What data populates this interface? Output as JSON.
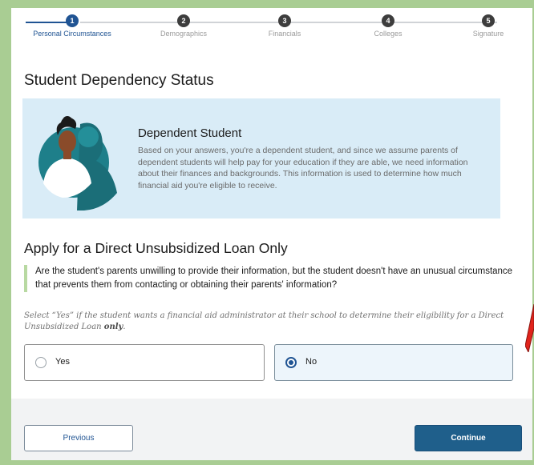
{
  "stepper": {
    "steps": [
      {
        "number": "1",
        "label": "Personal Circumstances"
      },
      {
        "number": "2",
        "label": "Demographics"
      },
      {
        "number": "3",
        "label": "Financials"
      },
      {
        "number": "4",
        "label": "Colleges"
      },
      {
        "number": "5",
        "label": "Signature"
      }
    ],
    "active_step": 1
  },
  "page_title": "Student Dependency Status",
  "info_box": {
    "title": "Dependent Student",
    "body": "Based on your answers, you're a dependent student, and since we assume parents of dependent students will help pay for your education if they are able, we need information about their finances and backgrounds. This information is used to determine how much financial aid you're eligible to receive."
  },
  "section_title": "Apply for a Direct Unsubsidized Loan Only",
  "question": "Are the student's parents unwilling to provide their information, but the student doesn't have an unusual circumstance that prevents them from contacting or obtaining their parents' information?",
  "hint": {
    "main": "Select “Yes” if the student wants a financial aid administrator at their school to determine their eligibility for a Direct Unsubsidized Loan",
    "emph": "only",
    "end": "."
  },
  "options": [
    {
      "label": "Yes",
      "selected": false
    },
    {
      "label": "No",
      "selected": true
    }
  ],
  "buttons": {
    "previous": "Previous",
    "continue": "Continue"
  },
  "colors": {
    "accent": "#205493",
    "info_bg": "#d9ecf7",
    "frame": "#a9cd93",
    "annotation": "#e0231b"
  }
}
